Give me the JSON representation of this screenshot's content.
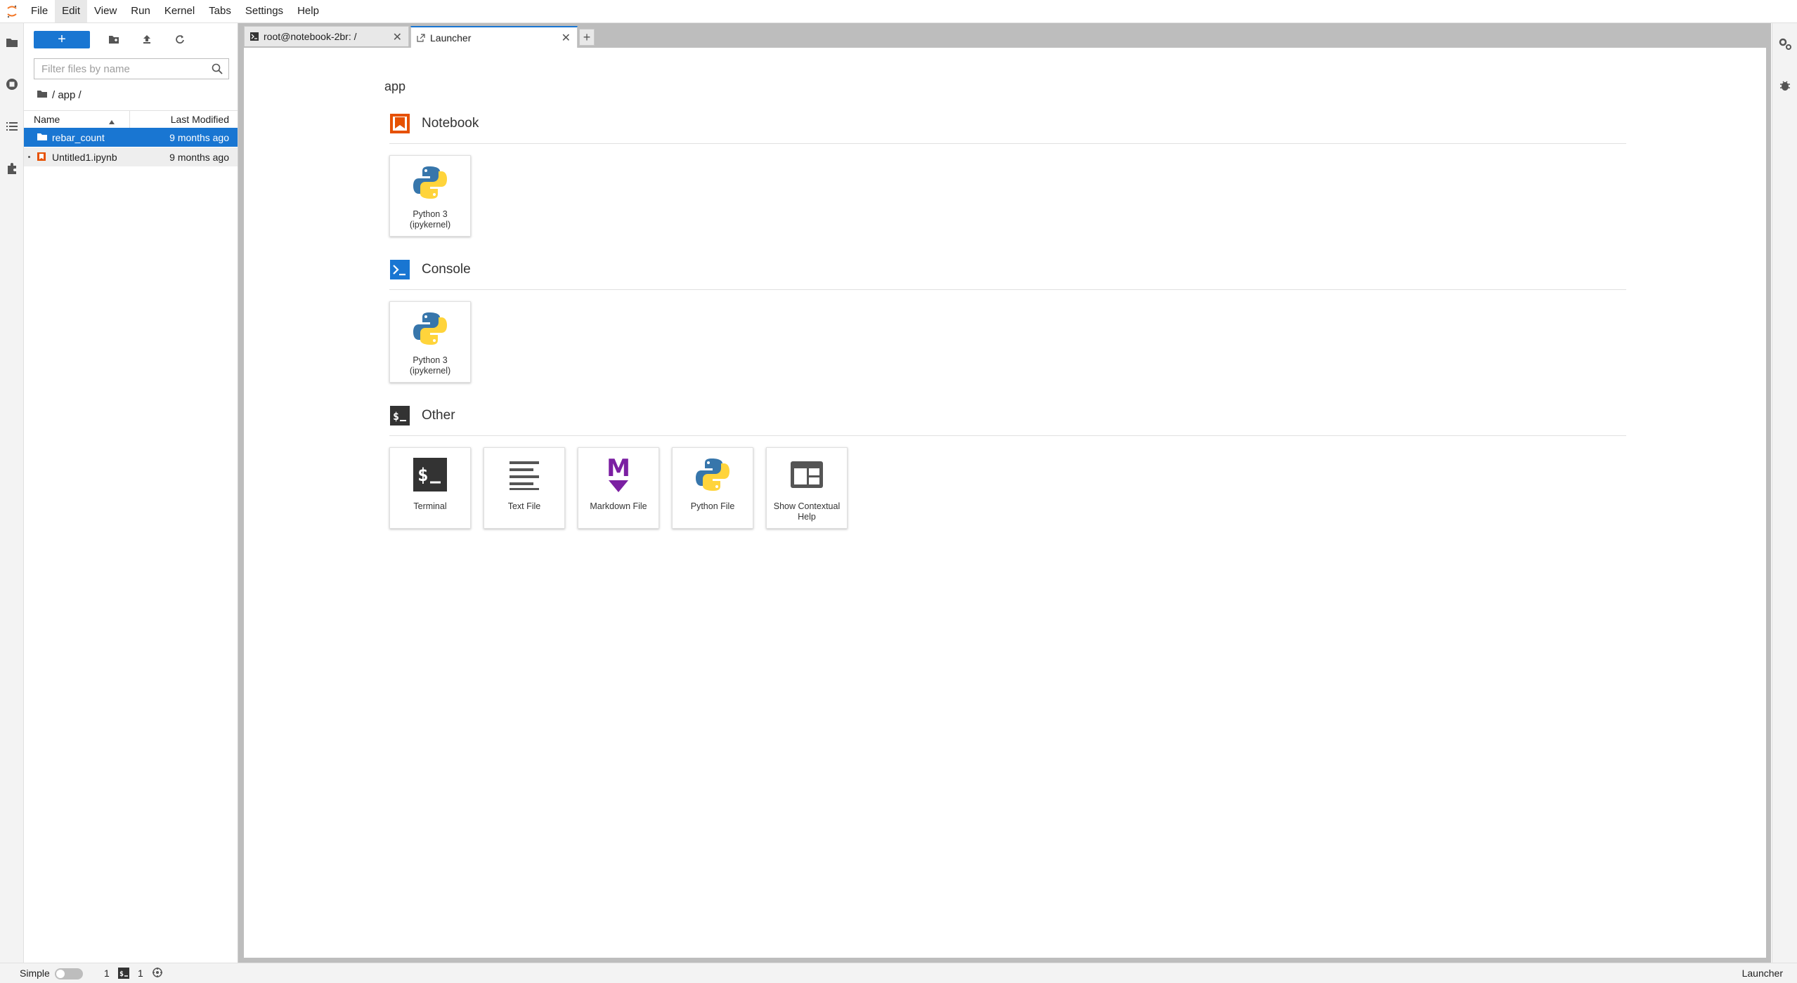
{
  "menubar": {
    "items": [
      "File",
      "Edit",
      "View",
      "Run",
      "Kernel",
      "Tabs",
      "Settings",
      "Help"
    ],
    "active_index": 1
  },
  "filebrowser": {
    "new_label": "+",
    "filter_placeholder": "Filter files by name",
    "breadcrumb": "/ app /",
    "columns": {
      "name": "Name",
      "modified": "Last Modified"
    },
    "files": [
      {
        "name": "rebar_count",
        "modified": "9 months ago",
        "type": "folder",
        "selected": true
      },
      {
        "name": "Untitled1.ipynb",
        "modified": "9 months ago",
        "type": "notebook",
        "selected": false
      }
    ]
  },
  "tabs": [
    {
      "label": "root@notebook-2br: /",
      "icon": "terminal-icon",
      "active": false
    },
    {
      "label": "Launcher",
      "icon": "launcher-icon",
      "active": true
    }
  ],
  "add_tab_label": "+",
  "launcher": {
    "cwd": "app",
    "sections": [
      {
        "title": "Notebook",
        "icon": "notebook-icon",
        "color": "#e65100",
        "cards": [
          {
            "label": "Python 3 (ipykernel)",
            "icon": "python-icon"
          }
        ]
      },
      {
        "title": "Console",
        "icon": "console-icon",
        "color": "#1976d2",
        "cards": [
          {
            "label": "Python 3 (ipykernel)",
            "icon": "python-icon"
          }
        ]
      },
      {
        "title": "Other",
        "icon": "terminal-section-icon",
        "color": "#333333",
        "cards": [
          {
            "label": "Terminal",
            "icon": "terminal-icon"
          },
          {
            "label": "Text File",
            "icon": "text-file-icon"
          },
          {
            "label": "Markdown File",
            "icon": "markdown-icon"
          },
          {
            "label": "Python File",
            "icon": "python-icon"
          },
          {
            "label": "Show Contextual Help",
            "icon": "contextual-help-icon"
          }
        ]
      }
    ]
  },
  "statusbar": {
    "simple_label": "Simple",
    "kernels_count": "1",
    "terminals_count": "1",
    "right_label": "Launcher"
  },
  "colors": {
    "accent": "#1976d2",
    "notebook": "#e65100",
    "markdown": "#7b1fa2"
  }
}
